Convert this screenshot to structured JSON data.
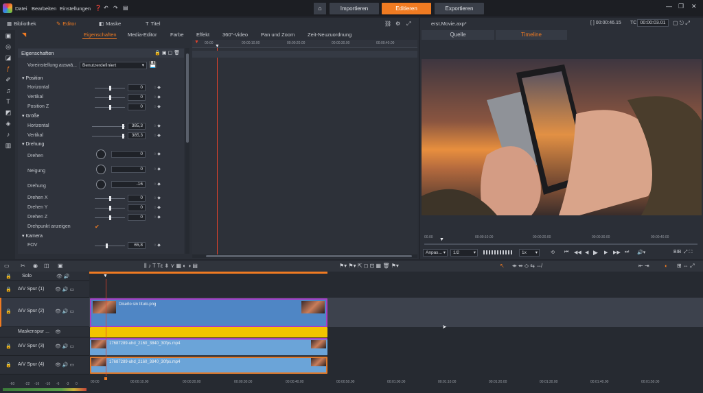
{
  "menubar": {
    "items": [
      "Datei",
      "Bearbeiten",
      "Einstellungen"
    ]
  },
  "modes": {
    "home_icon": "home-icon",
    "import": "Importieren",
    "edit": "Editieren",
    "export": "Exportieren"
  },
  "left_tabs": {
    "library": "Bibliothek",
    "editor": "Editor",
    "mask": "Maske",
    "title": "Titel"
  },
  "sub_tabs": [
    "Eigenschaften",
    "Media-Editor",
    "Farbe",
    "Effekt",
    "360°-Video",
    "Pan und Zoom",
    "Zeit-Neuzuordnung"
  ],
  "properties": {
    "header": "Eigenschaften",
    "preset_label": "Voreinstellung auswä...",
    "preset_value": "Benutzerdefiniert",
    "sections": {
      "position": "Position",
      "size": "Größe",
      "rotation": "Drehung",
      "camera": "Kamera"
    },
    "rows": {
      "horizontal": {
        "label": "Horizontal",
        "value": "0"
      },
      "vertical": {
        "label": "Vertikal",
        "value": "0"
      },
      "position_z": {
        "label": "Position Z",
        "value": "0"
      },
      "size_h": {
        "label": "Horizontal",
        "value": "385,3"
      },
      "size_v": {
        "label": "Vertikal",
        "value": "385,3"
      },
      "drehen": {
        "label": "Drehen",
        "value": "0"
      },
      "neigung": {
        "label": "Neigung",
        "value": "0"
      },
      "drehung": {
        "label": "Drehung",
        "value": "-16"
      },
      "drehen_x": {
        "label": "Drehen X",
        "value": "0"
      },
      "drehen_y": {
        "label": "Drehen Y",
        "value": "0"
      },
      "drehen_z": {
        "label": "Drehen Z",
        "value": "0"
      },
      "pivot": {
        "label": "Drehpunkt anzeigen"
      },
      "fov": {
        "label": "FOV",
        "value": "65,8"
      }
    }
  },
  "kf_ruler": [
    "00:00",
    "00:00:10.00",
    "00:00:20.00",
    "00:00:30.00",
    "00:00:40.00"
  ],
  "right": {
    "file": "erst.Movie.axp*",
    "duration": "[ ] 00:00:46.15",
    "tc_label": "TC",
    "timecode": "00:00:03.01",
    "tabs": {
      "source": "Quelle",
      "timeline": "Timeline"
    },
    "ruler": [
      "00.00",
      "00:00:10.00",
      "00:00:20.00",
      "00:00:30.00",
      "00:00:40.00"
    ],
    "fit": "Anpas...",
    "ratio": "1/2",
    "speed": "1x",
    "bib": "BIB"
  },
  "tracks": {
    "solo": "Solo",
    "track1": "A/V Spur (1)",
    "track2": "A/V Spur (2)",
    "mask": "Maskenspur ...",
    "track3": "A/V Spur (3)",
    "track4": "A/V Spur (4)"
  },
  "clips": {
    "clip2": "Diseño sin título.png",
    "clip3": "17687289-uhd_2160_3840_30fps.mp4",
    "clip4": "17687289-uhd_2160_3840_30fps.mp4"
  },
  "bottom_ruler": [
    "00:00",
    "00:00:10.00",
    "00:00:20.00",
    "00:00:30.00",
    "00:00:40.00",
    "00:00:50.00",
    "00:01:00.00",
    "00:01:10.00",
    "00:01:20.00",
    "00:01:30.00",
    "00:01:40.00",
    "00:01:50.00"
  ],
  "meter_labels": [
    "-60",
    "-22",
    "-16",
    "-10",
    "-6",
    "-3",
    "0"
  ],
  "colors": {
    "accent": "#f07b22",
    "clip_blue": "#5b8cc8",
    "mask_yellow": "#f2c500",
    "clip_border": "#a63fc6"
  }
}
